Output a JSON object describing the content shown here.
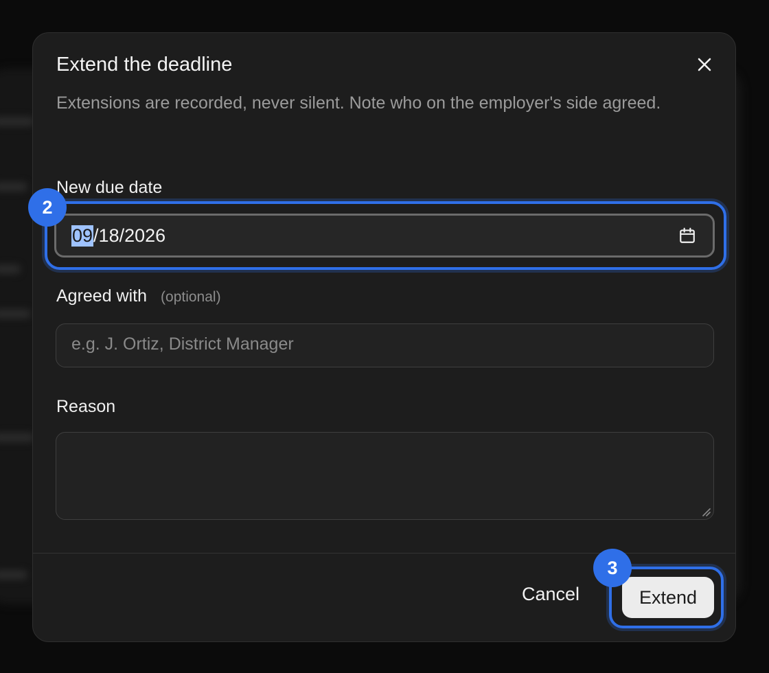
{
  "dialog": {
    "title": "Extend the deadline",
    "description": "Extensions are recorded, never silent. Note who on the employer's side agreed.",
    "close_icon": "close-icon"
  },
  "fields": {
    "due_date": {
      "label": "New due date",
      "value_selected_segment": "09",
      "value_rest": "/18/2026",
      "icon": "calendar-icon"
    },
    "agreed_with": {
      "label": "Agreed with",
      "hint": "(optional)",
      "placeholder": "e.g. J. Ortiz, District Manager",
      "value": ""
    },
    "reason": {
      "label": "Reason",
      "value": ""
    }
  },
  "footer": {
    "cancel_label": "Cancel",
    "extend_label": "Extend"
  },
  "markers": {
    "date_marker": "2",
    "extend_marker": "3"
  },
  "colors": {
    "accent": "#2f6fe8",
    "selection": "#9fc3ff",
    "dialog_bg": "#1d1d1d"
  }
}
